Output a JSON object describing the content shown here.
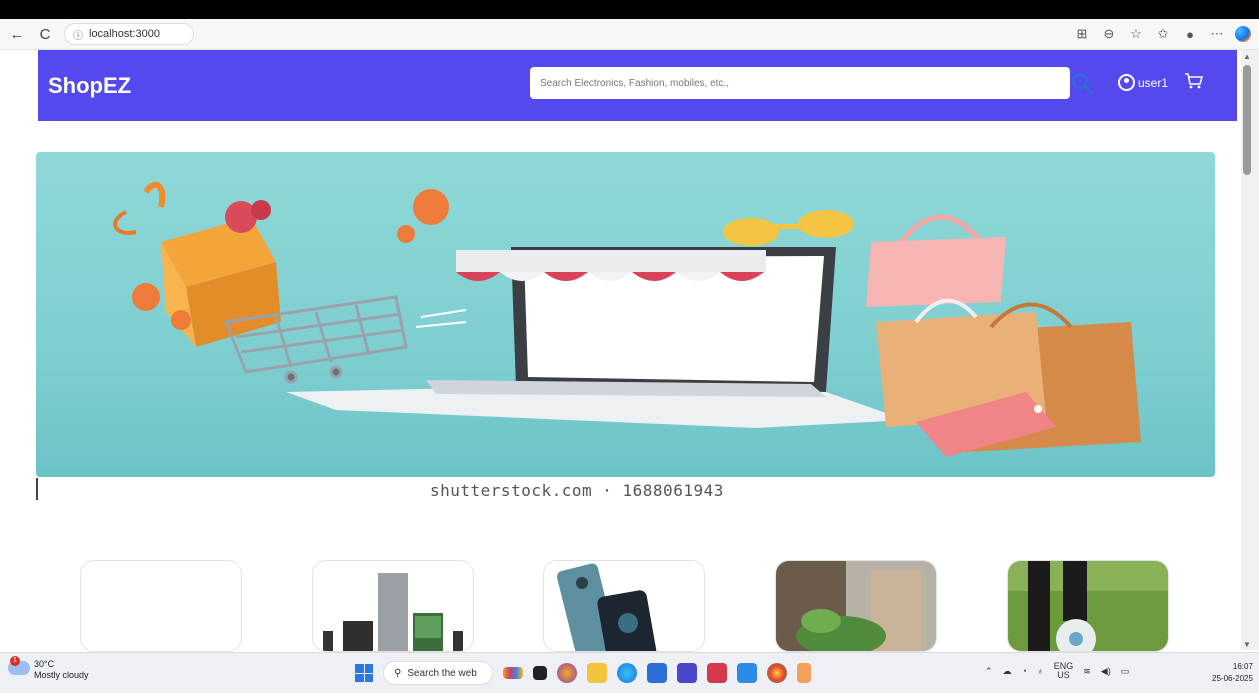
{
  "browser": {
    "url": "localhost:3000",
    "back_icon": "←",
    "reload_icon": "C"
  },
  "header": {
    "brand": "ShopEZ",
    "search_placeholder": "Search Electronics, Fashion, mobiles, etc.,",
    "user_label": "user1"
  },
  "banner": {
    "watermark": "shutterstock.com · 1688061943"
  },
  "taskbar": {
    "weather_temp": "30°C",
    "weather_desc": "Mostly cloudy",
    "weather_alert": "1",
    "search_label": "Search the web",
    "lang_top": "ENG",
    "lang_bottom": "US",
    "time": "16:07",
    "date": "25-06-2025"
  },
  "colors": {
    "header": "#5349ee",
    "banner": "#8fd8d8",
    "taskbar": "#eef0f5"
  }
}
